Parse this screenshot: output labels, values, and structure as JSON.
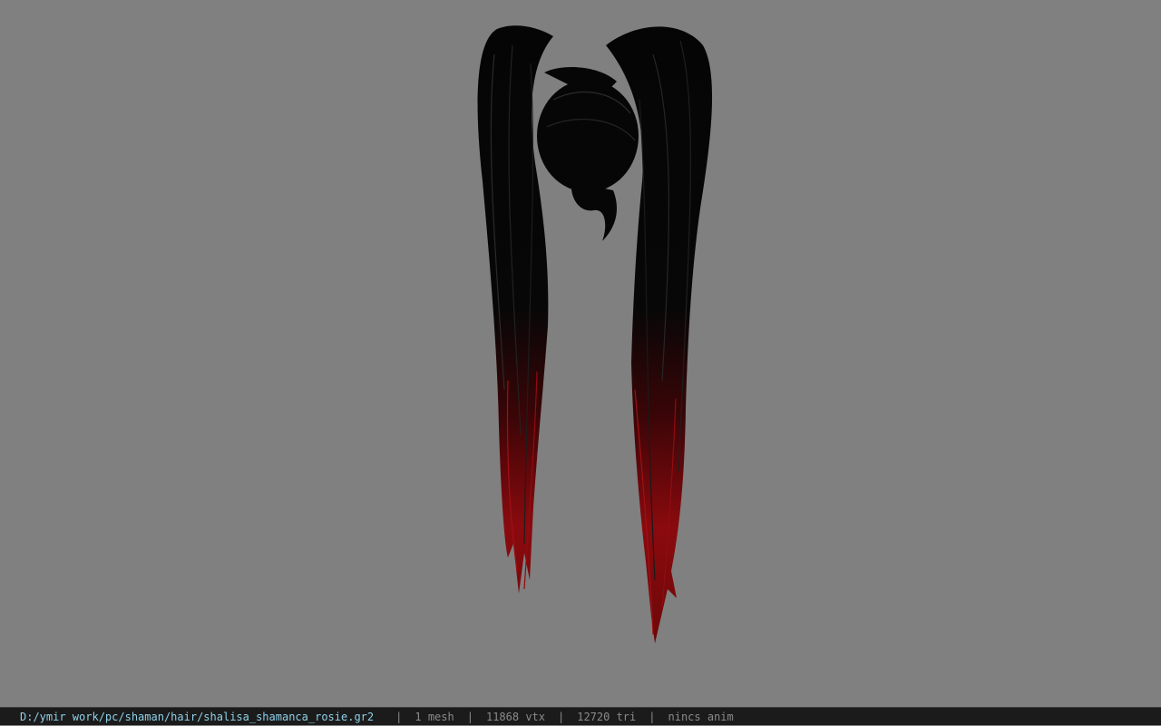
{
  "viewer": {
    "background_color": "#808080",
    "model_preview": {
      "icon": "hair-model-render",
      "hair_color": "#050505",
      "tip_color": "#8a0a0e"
    }
  },
  "status_bar": {
    "file_path": "D:/ymir work/pc/shaman/hair/shalisa_shamanca_rosie.gr2",
    "separator": "|",
    "mesh_count": "1 mesh",
    "vertex_count": "11868 vtx",
    "triangle_count": "12720 tri",
    "animation": "nincs anim"
  }
}
